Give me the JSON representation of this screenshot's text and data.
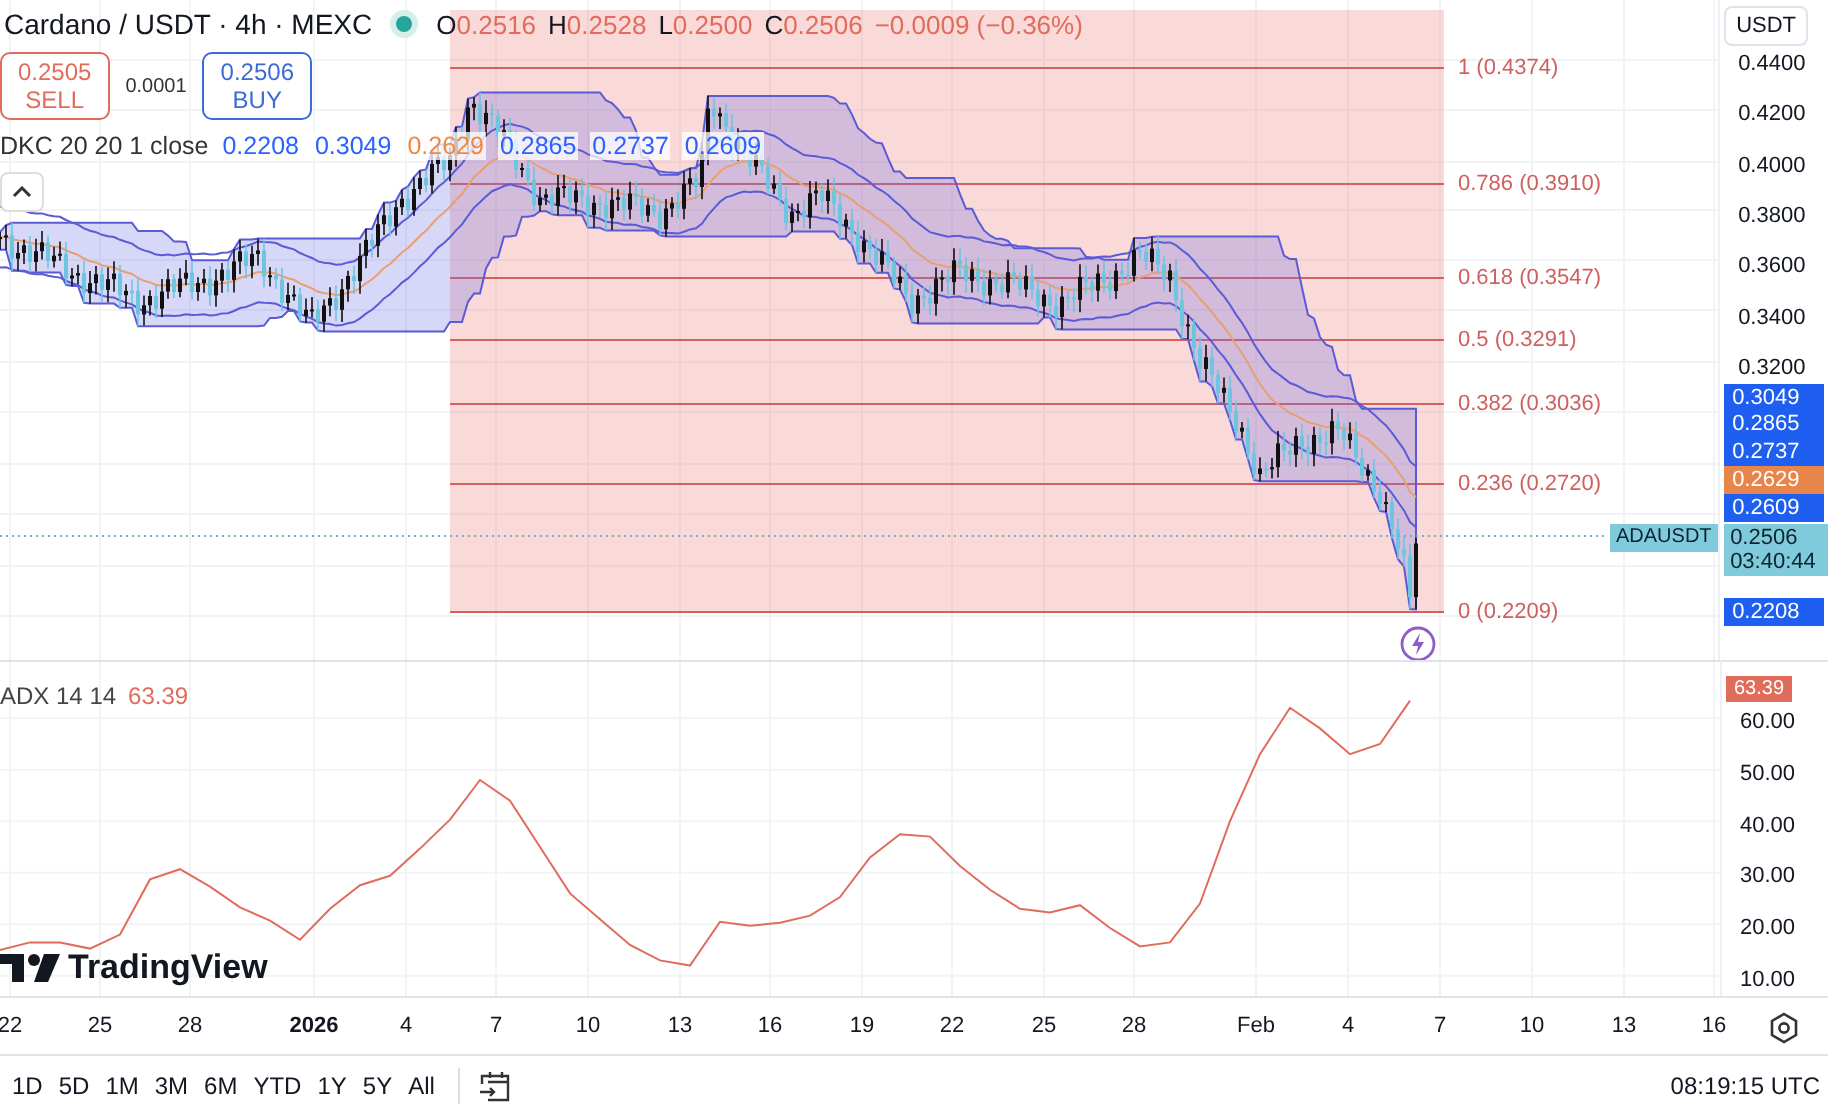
{
  "header": {
    "title": "Cardano / USDT · 4h · MEXC",
    "ohlc": [
      {
        "key": "O",
        "value": "0.2516"
      },
      {
        "key": "H",
        "value": "0.2528"
      },
      {
        "key": "L",
        "value": "0.2500"
      },
      {
        "key": "C",
        "value": "0.2506"
      }
    ],
    "change": "−0.0009 (−0.36%)"
  },
  "trade": {
    "sell": {
      "price": "0.2505",
      "label": "SELL"
    },
    "spread": "0.0001",
    "buy": {
      "price": "0.2506",
      "label": "BUY"
    }
  },
  "dkc": {
    "label": "DKC 20 20 1 close",
    "values": [
      {
        "text": "0.2208",
        "color": "#2962ff"
      },
      {
        "text": "0.3049",
        "color": "#2962ff"
      },
      {
        "text": "0.2629",
        "color": "#f0883e"
      },
      {
        "text": "0.2865",
        "color": "#2962ff"
      },
      {
        "text": "0.2737",
        "color": "#2962ff"
      },
      {
        "text": "0.2609",
        "color": "#2962ff"
      }
    ]
  },
  "fib_levels": [
    "1 (0.4374)",
    "0.786 (0.3910)",
    "0.618 (0.3547)",
    "0.5 (0.3291)",
    "0.382 (0.3036)",
    "0.236 (0.2720)",
    "0 (0.2209)"
  ],
  "price_axis": {
    "currency": "USDT",
    "ticks": [
      "0.4400",
      "0.4200",
      "0.4000",
      "0.3800",
      "0.3600",
      "0.3400",
      "0.3200"
    ]
  },
  "price_tags": [
    {
      "text": "0.3049",
      "color": "#1e5ef0"
    },
    {
      "text": "0.2865",
      "color": "#1e5ef0"
    },
    {
      "text": "0.2737",
      "color": "#1e5ef0"
    },
    {
      "text": "0.2629",
      "color": "#e8854a"
    },
    {
      "text": "0.2609",
      "color": "#1e5ef0"
    },
    {
      "text": "0.2208",
      "color": "#1e5ef0"
    }
  ],
  "last_price": {
    "symbol": "ADAUSDT",
    "price": "0.2506",
    "countdown": "03:40:44"
  },
  "adx": {
    "value": "63.39",
    "value_tag": "63.39",
    "chart_data": {
      "type": "line",
      "series": [
        {
          "name": "ADX 14 14",
          "color": "#e06c5c",
          "values": [
            15,
            16.5,
            16.5,
            15.3,
            18,
            28.7,
            30.7,
            27.3,
            23.3,
            20.7,
            17,
            23,
            27.6,
            29.4,
            34.7,
            40.3,
            48,
            44,
            35,
            26,
            21,
            16,
            13,
            12,
            20.5,
            19.7,
            20.3,
            21.7,
            25.3,
            33,
            37.5,
            37,
            31.3,
            26.7,
            23,
            22.3,
            23.7,
            19.3,
            15.7,
            16.5,
            24,
            40,
            53,
            62,
            58,
            53,
            55,
            63.4
          ]
        }
      ],
      "ylim": [
        5.7,
        70.9
      ],
      "grid": true,
      "yticks": [
        {
          "value": 60,
          "label": "60.00"
        },
        {
          "value": 50,
          "label": "50.00"
        },
        {
          "value": 40,
          "label": "40.00"
        },
        {
          "value": 30,
          "label": "30.00"
        },
        {
          "value": 20,
          "label": "20.00"
        },
        {
          "value": 10,
          "label": "10.00"
        }
      ]
    }
  },
  "logo": "TradingView",
  "date_axis": [
    {
      "label": "22",
      "bold": false
    },
    {
      "label": "25",
      "bold": false
    },
    {
      "label": "28",
      "bold": false
    },
    {
      "label": "2026",
      "bold": true
    },
    {
      "label": "4",
      "bold": false
    },
    {
      "label": "7",
      "bold": false
    },
    {
      "label": "10",
      "bold": false
    },
    {
      "label": "13",
      "bold": false
    },
    {
      "label": "16",
      "bold": false
    },
    {
      "label": "19",
      "bold": false
    },
    {
      "label": "22",
      "bold": false
    },
    {
      "label": "25",
      "bold": false
    },
    {
      "label": "28",
      "bold": false
    },
    {
      "label": "Feb",
      "bold": false
    },
    {
      "label": "4",
      "bold": false
    },
    {
      "label": "7",
      "bold": false
    },
    {
      "label": "10",
      "bold": false
    },
    {
      "label": "13",
      "bold": false
    },
    {
      "label": "16",
      "bold": false
    }
  ],
  "ranges": [
    "1D",
    "5D",
    "1M",
    "3M",
    "6M",
    "YTD",
    "1Y",
    "5Y",
    "All"
  ],
  "clock": "08:19:15 UTC"
}
